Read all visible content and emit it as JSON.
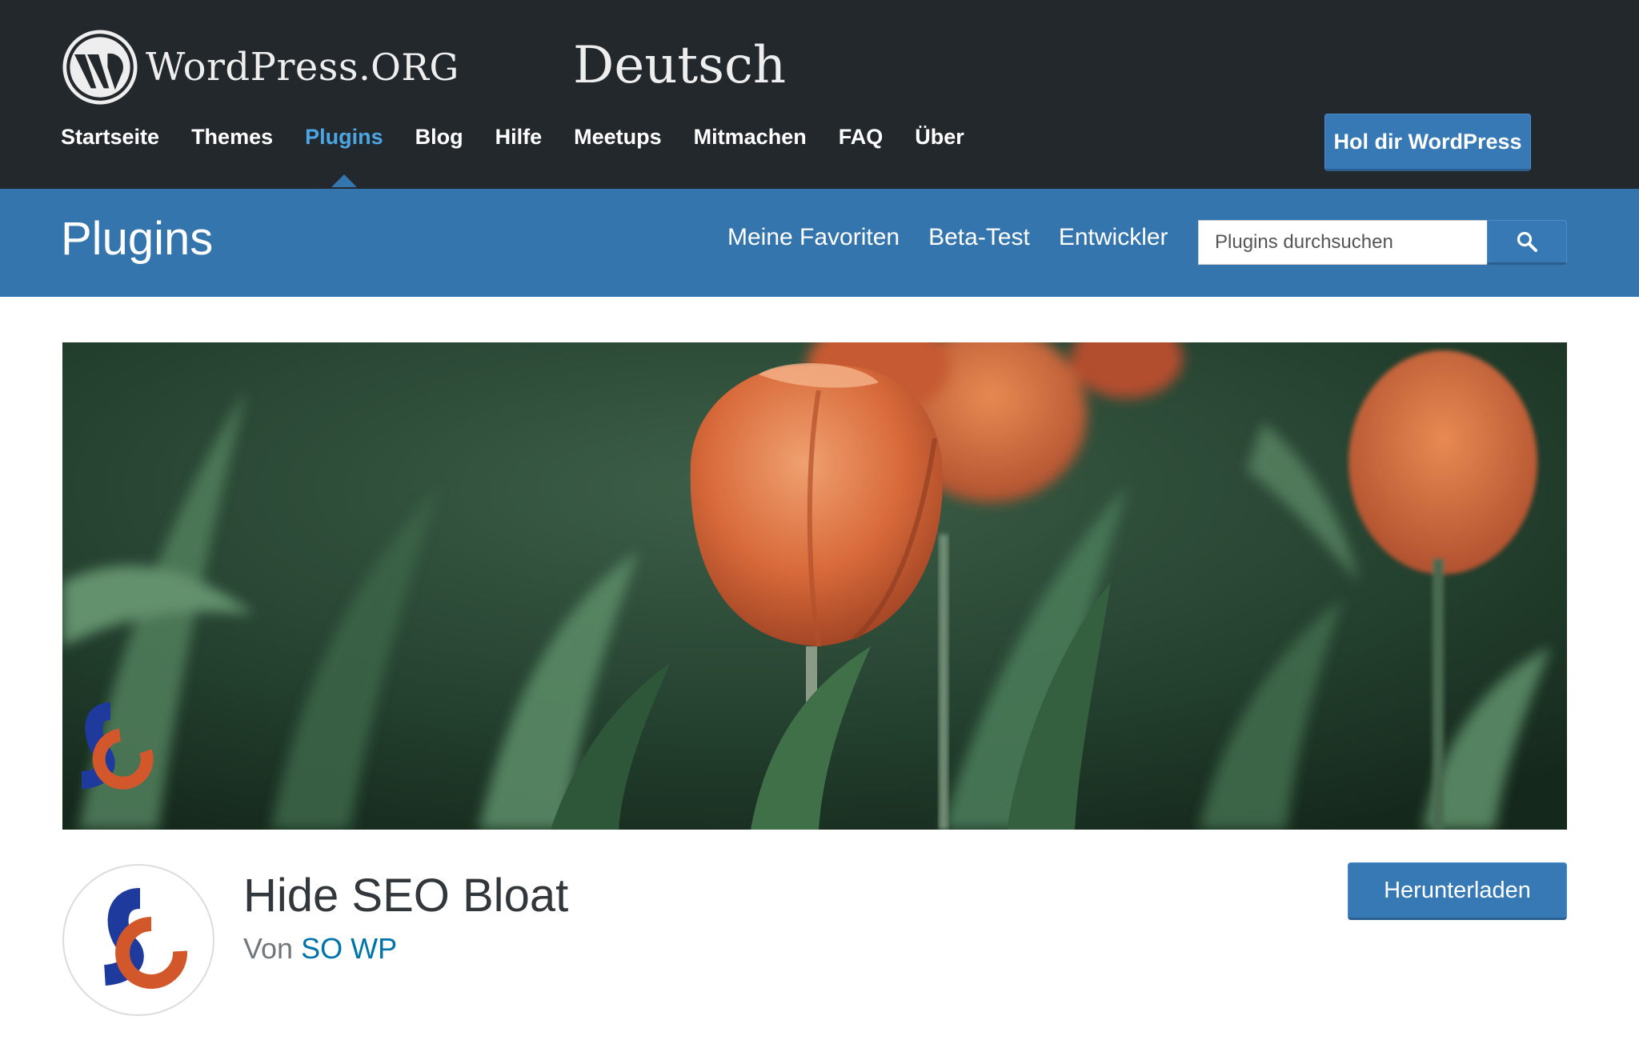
{
  "header": {
    "brand_main": "WordPress",
    "brand_suffix": ".ORG",
    "locale": "Deutsch",
    "nav": [
      {
        "label": "Startseite",
        "active": false
      },
      {
        "label": "Themes",
        "active": false
      },
      {
        "label": "Plugins",
        "active": true
      },
      {
        "label": "Blog",
        "active": false
      },
      {
        "label": "Hilfe",
        "active": false
      },
      {
        "label": "Meetups",
        "active": false
      },
      {
        "label": "Mitmachen",
        "active": false
      },
      {
        "label": "FAQ",
        "active": false
      },
      {
        "label": "Über",
        "active": false
      }
    ],
    "cta_label": "Hol dir WordPress"
  },
  "plugin_bar": {
    "title": "Plugins",
    "links": [
      "Meine Favoriten",
      "Beta-Test",
      "Entwickler"
    ],
    "search_placeholder": "Plugins durchsuchen",
    "search_icon": "search-icon"
  },
  "plugin": {
    "name": "Hide SEO Bloat",
    "author_prefix": "Von",
    "author": "SO WP",
    "download_label": "Herunterladen",
    "banner_image": "orange-tulips-photo",
    "logo": "so-wp-logo"
  },
  "colors": {
    "header_bg": "#23282d",
    "plugin_bar_bg": "#3575ad",
    "button_bg": "#3679b5",
    "active_nav": "#4ca6e3",
    "author_link": "#0073aa",
    "logo_blue": "#1e3a9c",
    "logo_orange": "#d2582c"
  }
}
